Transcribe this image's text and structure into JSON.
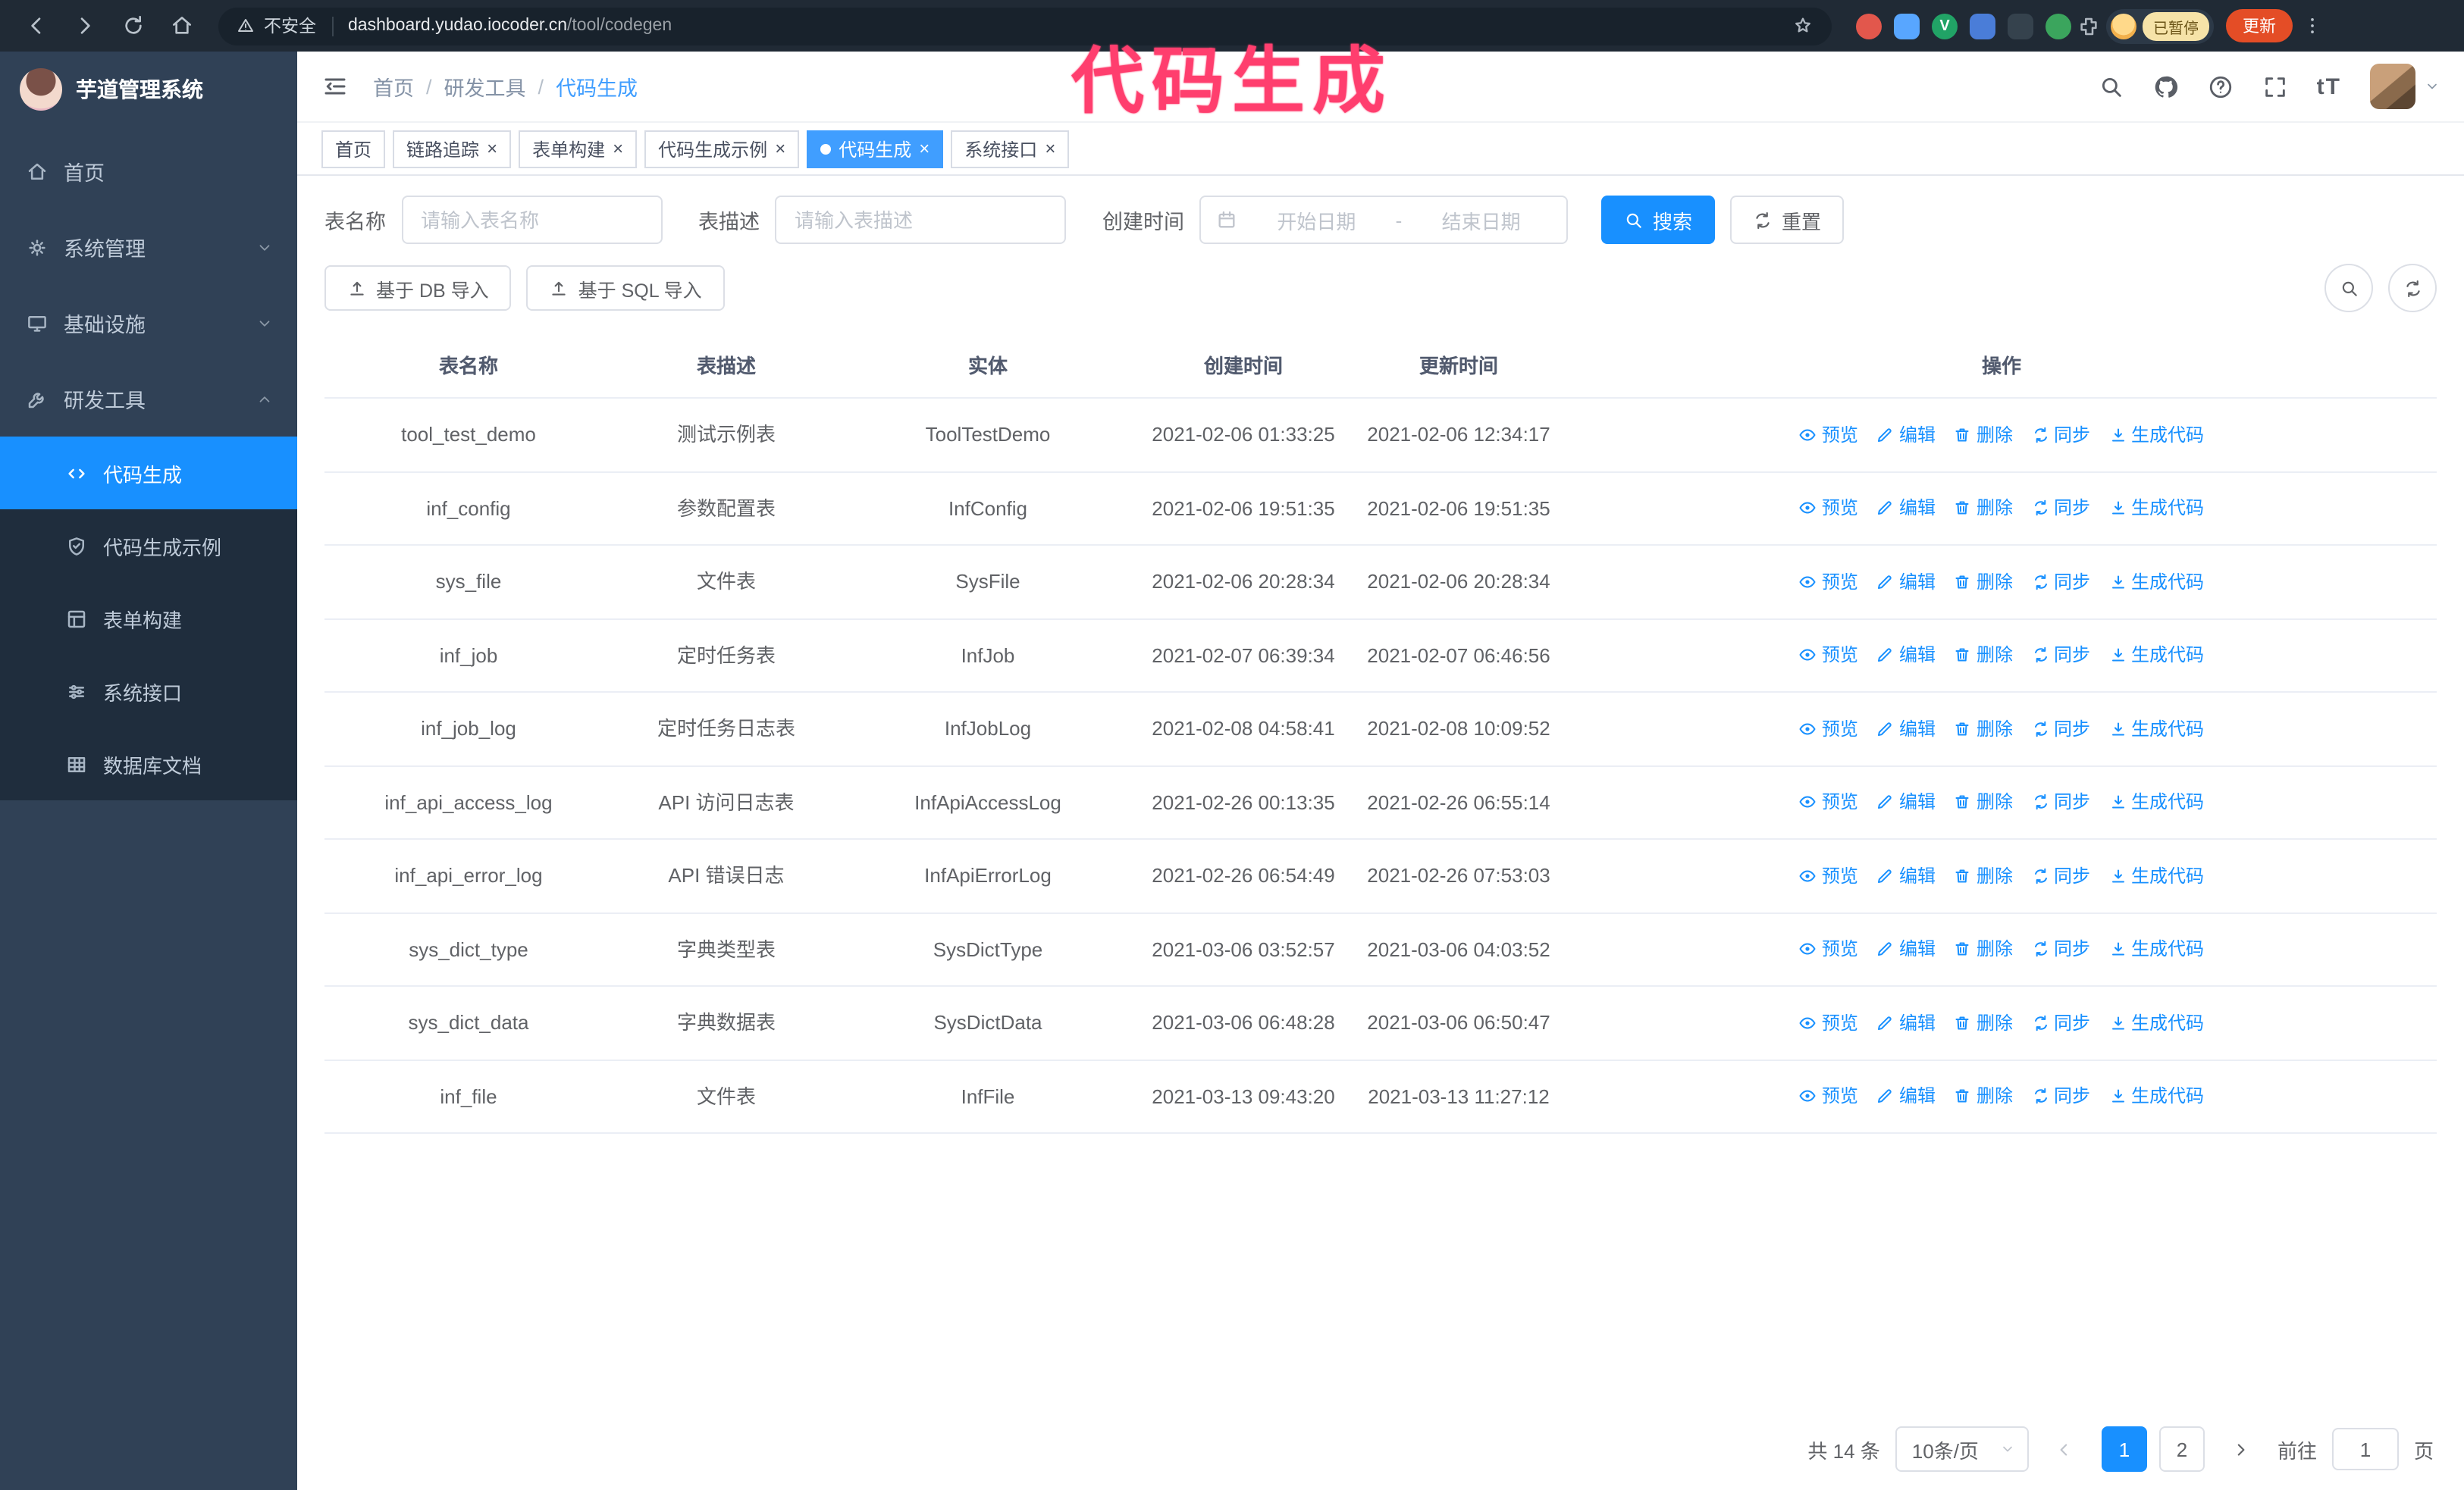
{
  "colors": {
    "primary": "#1890ff",
    "tag_active": "#409eff",
    "sidebar_bg": "#304156",
    "submenu_bg": "#1f2d3d",
    "annotation": "#ff3e6e",
    "update_button": "#e44d26",
    "paused_badge_bg": "#f6e3a8"
  },
  "annotation": {
    "text": "代码生成"
  },
  "browser": {
    "security_label": "不安全",
    "url_host": "dashboard.yudao.iocoder.cn",
    "url_path": "/tool/codegen",
    "paused_badge": "已暂停",
    "update_button": "更新",
    "extensions": [
      {
        "name": "extension-icon",
        "color": "#e2574c",
        "round": true,
        "letter": ""
      },
      {
        "name": "extension-icon",
        "color": "#58a6ff",
        "round": false,
        "letter": ""
      },
      {
        "name": "extension-icon",
        "color": "#21a366",
        "round": true,
        "letter": "V"
      },
      {
        "name": "extension-icon",
        "color": "#4a7dd8",
        "round": false,
        "letter": ""
      },
      {
        "name": "extension-icon",
        "color": "#35424d",
        "round": false,
        "letter": ""
      },
      {
        "name": "extension-icon",
        "color": "#3ba55d",
        "round": true,
        "letter": ""
      }
    ]
  },
  "sidebar": {
    "title": "芋道管理系统",
    "menu": [
      {
        "id": "home",
        "label": "首页",
        "icon": "home-icon",
        "expandable": false,
        "expanded": false
      },
      {
        "id": "system",
        "label": "系统管理",
        "icon": "gear-icon",
        "expandable": true,
        "expanded": false
      },
      {
        "id": "infra",
        "label": "基础设施",
        "icon": "infra-icon",
        "expandable": true,
        "expanded": false
      },
      {
        "id": "devtools",
        "label": "研发工具",
        "icon": "tools-icon",
        "expandable": true,
        "expanded": true
      }
    ],
    "submenu": [
      {
        "id": "codegen",
        "label": "代码生成",
        "icon": "code-icon",
        "active": true
      },
      {
        "id": "codegen-demo",
        "label": "代码生成示例",
        "icon": "shield-icon",
        "active": false
      },
      {
        "id": "form-builder",
        "label": "表单构建",
        "icon": "form-icon",
        "active": false
      },
      {
        "id": "api",
        "label": "系统接口",
        "icon": "sliders-icon",
        "active": false
      },
      {
        "id": "db-doc",
        "label": "数据库文档",
        "icon": "table-icon",
        "active": false
      }
    ]
  },
  "header": {
    "breadcrumb": [
      "首页",
      "研发工具",
      "代码生成"
    ],
    "breadcrumb_separator": "/",
    "fontsize_label": "tT",
    "action_icons": [
      "search-icon",
      "github-icon",
      "question-icon",
      "fullscreen-icon"
    ]
  },
  "tags": {
    "close_glyph": "×",
    "items": [
      {
        "label": "首页",
        "closable": false,
        "active": false
      },
      {
        "label": "链路追踪",
        "closable": true,
        "active": false
      },
      {
        "label": "表单构建",
        "closable": true,
        "active": false
      },
      {
        "label": "代码生成示例",
        "closable": true,
        "active": false
      },
      {
        "label": "代码生成",
        "closable": true,
        "active": true
      },
      {
        "label": "系统接口",
        "closable": true,
        "active": false
      }
    ]
  },
  "filters": {
    "name_label": "表名称",
    "name_placeholder": "请输入表名称",
    "desc_label": "表描述",
    "desc_placeholder": "请输入表描述",
    "time_label": "创建时间",
    "start_placeholder": "开始日期",
    "range_separator": "-",
    "end_placeholder": "结束日期",
    "search_label": "搜索",
    "reset_label": "重置"
  },
  "toolbar": {
    "db_import_label": "基于 DB 导入",
    "sql_import_label": "基于 SQL 导入"
  },
  "table": {
    "columns": [
      "表名称",
      "表描述",
      "实体",
      "创建时间",
      "更新时间",
      "操作"
    ],
    "actions": [
      {
        "id": "preview",
        "label": "预览",
        "icon": "eye-icon"
      },
      {
        "id": "edit",
        "label": "编辑",
        "icon": "pencil-icon"
      },
      {
        "id": "delete",
        "label": "删除",
        "icon": "trash-icon"
      },
      {
        "id": "sync",
        "label": "同步",
        "icon": "sync-icon"
      },
      {
        "id": "generate",
        "label": "生成代码",
        "icon": "download-icon"
      }
    ],
    "rows": [
      {
        "name": "tool_test_demo",
        "desc": "测试示例表",
        "entity": "ToolTestDemo",
        "created": "2021-02-06 01:33:25",
        "updated": "2021-02-06 12:34:17"
      },
      {
        "name": "inf_config",
        "desc": "参数配置表",
        "entity": "InfConfig",
        "created": "2021-02-06 19:51:35",
        "updated": "2021-02-06 19:51:35"
      },
      {
        "name": "sys_file",
        "desc": "文件表",
        "entity": "SysFile",
        "created": "2021-02-06 20:28:34",
        "updated": "2021-02-06 20:28:34"
      },
      {
        "name": "inf_job",
        "desc": "定时任务表",
        "entity": "InfJob",
        "created": "2021-02-07 06:39:34",
        "updated": "2021-02-07 06:46:56"
      },
      {
        "name": "inf_job_log",
        "desc": "定时任务日志表",
        "entity": "InfJobLog",
        "created": "2021-02-08 04:58:41",
        "updated": "2021-02-08 10:09:52"
      },
      {
        "name": "inf_api_access_log",
        "desc": "API 访问日志表",
        "entity": "InfApiAccessLog",
        "created": "2021-02-26 00:13:35",
        "updated": "2021-02-26 06:55:14"
      },
      {
        "name": "inf_api_error_log",
        "desc": "API 错误日志",
        "entity": "InfApiErrorLog",
        "created": "2021-02-26 06:54:49",
        "updated": "2021-02-26 07:53:03"
      },
      {
        "name": "sys_dict_type",
        "desc": "字典类型表",
        "entity": "SysDictType",
        "created": "2021-03-06 03:52:57",
        "updated": "2021-03-06 04:03:52"
      },
      {
        "name": "sys_dict_data",
        "desc": "字典数据表",
        "entity": "SysDictData",
        "created": "2021-03-06 06:48:28",
        "updated": "2021-03-06 06:50:47"
      },
      {
        "name": "inf_file",
        "desc": "文件表",
        "entity": "InfFile",
        "created": "2021-03-13 09:43:20",
        "updated": "2021-03-13 11:27:12"
      }
    ]
  },
  "pagination": {
    "total_label": "共 14 条",
    "page_size_label": "10条/页",
    "pages": [
      "1",
      "2"
    ],
    "current": "1",
    "goto_label": "前往",
    "goto_value": "1",
    "goto_unit": "页"
  }
}
